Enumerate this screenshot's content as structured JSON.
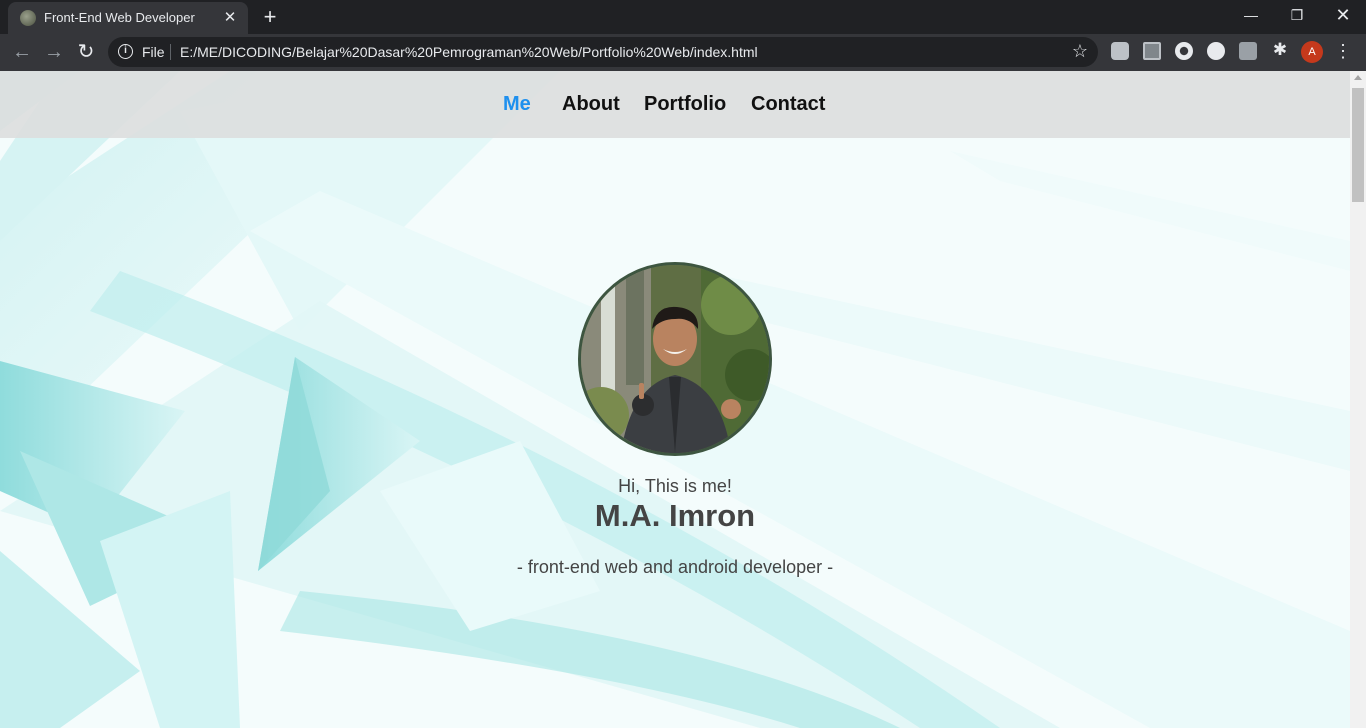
{
  "browser": {
    "tab_title": "Front-End Web Developer",
    "tab_close_glyph": "✕",
    "new_tab_glyph": "+",
    "window_controls": {
      "minimize": "—",
      "maximize": "❐",
      "close": "✕"
    },
    "nav": {
      "back": "←",
      "forward": "→",
      "reload": "↻"
    },
    "info_glyph": "i",
    "scheme_label": "File",
    "url": "E:/ME/DICODING/Belajar%20Dasar%20Pemrograman%20Web/Portfolio%20Web/index.html",
    "star_glyph": "☆",
    "puzzle_glyph": "✱",
    "profile_initial": "A",
    "menu_glyph": "⋮",
    "icons": [
      "info-icon",
      "star-icon",
      "extensions-icon",
      "profile-avatar",
      "menu-icon"
    ]
  },
  "site": {
    "nav": [
      {
        "label": "Me",
        "active": true
      },
      {
        "label": "About",
        "active": false
      },
      {
        "label": "Portfolio",
        "active": false
      },
      {
        "label": "Contact",
        "active": false
      }
    ],
    "greeting": "Hi, This is me!",
    "name": "M.A. Imron",
    "tagline": "- front-end web and android developer -"
  },
  "colors": {
    "chrome_bg": "#202124",
    "toolbar_bg": "#35363a",
    "nav_active": "#1e90ee",
    "nav_text": "#111111",
    "page_bg": "#f3fcfc",
    "accent_teal": "#9fe1e0",
    "profile_avatar": "#c5391c"
  }
}
